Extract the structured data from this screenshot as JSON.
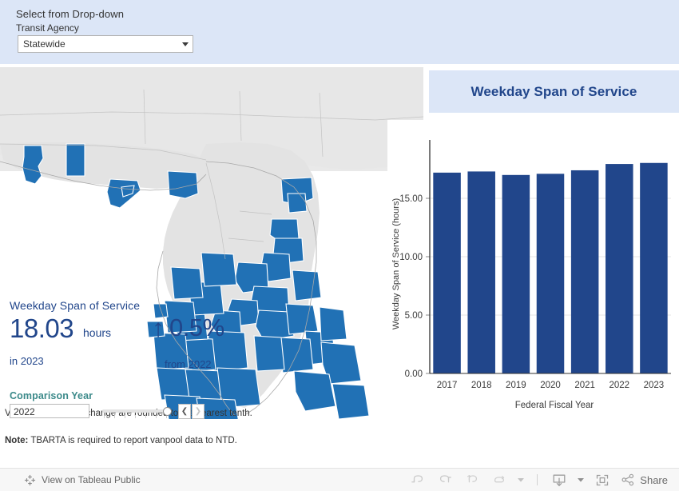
{
  "filter": {
    "title": "Select from Drop-down",
    "label": "Transit Agency",
    "value": "Statewide",
    "caret_icon": "chevron-down-icon"
  },
  "kpi": {
    "title": "Weekday Span of Service",
    "value": "18.03",
    "unit": "hours",
    "period": "in 2023",
    "arrow": "↑",
    "delta": "0.5%",
    "delta_sub": "from 2022",
    "color": "#21468b"
  },
  "comparison": {
    "label": "Comparison Year",
    "value": "2022",
    "prev_icon": "chevron-left-icon",
    "next_icon": "chevron-right-icon",
    "accent": "#3c8a8a"
  },
  "notes": {
    "note1": "Values and percent change are rounded to the nearest tenth.",
    "note2_bold": "Note:",
    "note2": " TBARTA is required to report vanpool data to NTD."
  },
  "chart_header": {
    "title": "Weekday Span of Service",
    "band_color": "#dce6f7",
    "title_color": "#21468b"
  },
  "chart_data": {
    "type": "bar",
    "title": "Weekday Span of Service",
    "categories": [
      "2017",
      "2018",
      "2019",
      "2020",
      "2021",
      "2022",
      "2023"
    ],
    "values": [
      17.2,
      17.3,
      17.0,
      17.1,
      17.4,
      17.94,
      18.03
    ],
    "xlabel": "Federal Fiscal Year",
    "ylabel": "Weekday Span of Service (hours)",
    "ylim": [
      0,
      20
    ],
    "yticks": [
      "0.00",
      "5.00",
      "10.00",
      "15.00"
    ],
    "ytick_values": [
      0,
      5,
      10,
      15
    ],
    "grid": true,
    "legend": "none",
    "bar_color": "#21468b"
  },
  "map": {
    "name": "florida-county-choropleth",
    "selected_color": "#2171b5",
    "unselected_color": "#e3e3e3"
  },
  "toolbar": {
    "view_label": "View on Tableau Public",
    "logo_icon": "tableau-logo-icon",
    "undo_icon": "undo-icon",
    "redo_icon": "redo-icon",
    "revert_icon": "revert-icon",
    "refresh_icon": "refresh-icon",
    "pause_caret_icon": "chevron-down-icon",
    "download_icon": "download-icon",
    "download_caret_icon": "chevron-down-icon",
    "fullscreen_icon": "fullscreen-icon",
    "share_icon": "share-icon",
    "share_label": "Share"
  }
}
